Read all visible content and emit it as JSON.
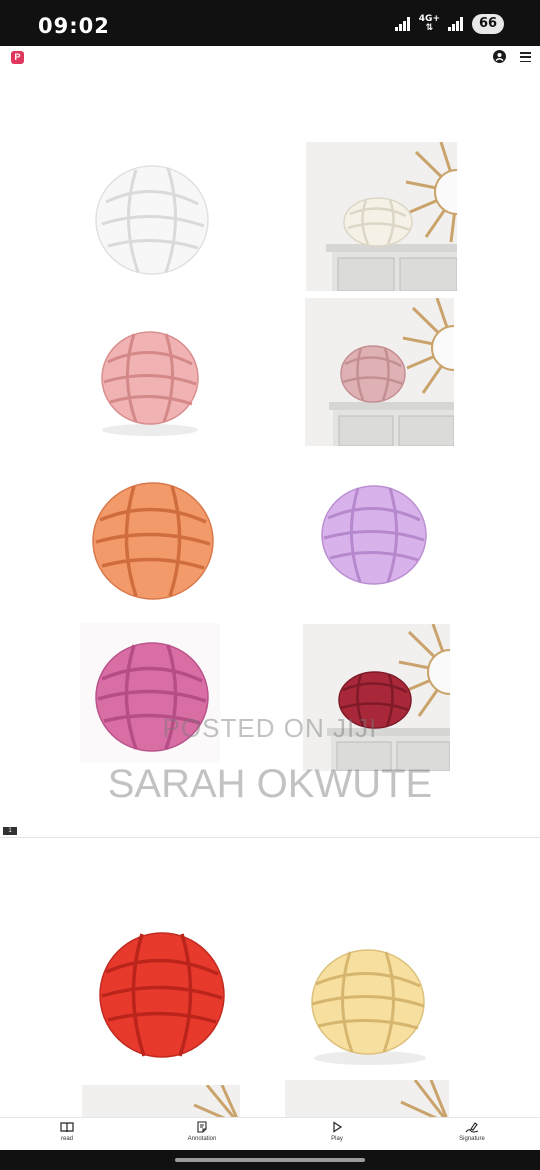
{
  "status_bar": {
    "time": "09:02",
    "network": "4G+",
    "battery": "66"
  },
  "header": {
    "logo_text": "P"
  },
  "document": {
    "page_number": "1",
    "watermark_line1": "POSTED ON JIJI",
    "watermark_line2": "SARAH OKWUTE"
  },
  "colors": {
    "white_knot": "#f7f7f7",
    "pink_knot": "#f0b2b2",
    "orange_knot": "#f39a6a",
    "lilac_knot": "#d8b2ea",
    "mauve_knot": "#d96ea5",
    "burgundy_knot": "#a8283a",
    "red_knot": "#e8392d",
    "cream_knot": "#f7dfa0"
  },
  "toolbar": {
    "read_label": "read",
    "annotation_label": "Annotation",
    "play_label": "Play",
    "signature_label": "Signature"
  }
}
